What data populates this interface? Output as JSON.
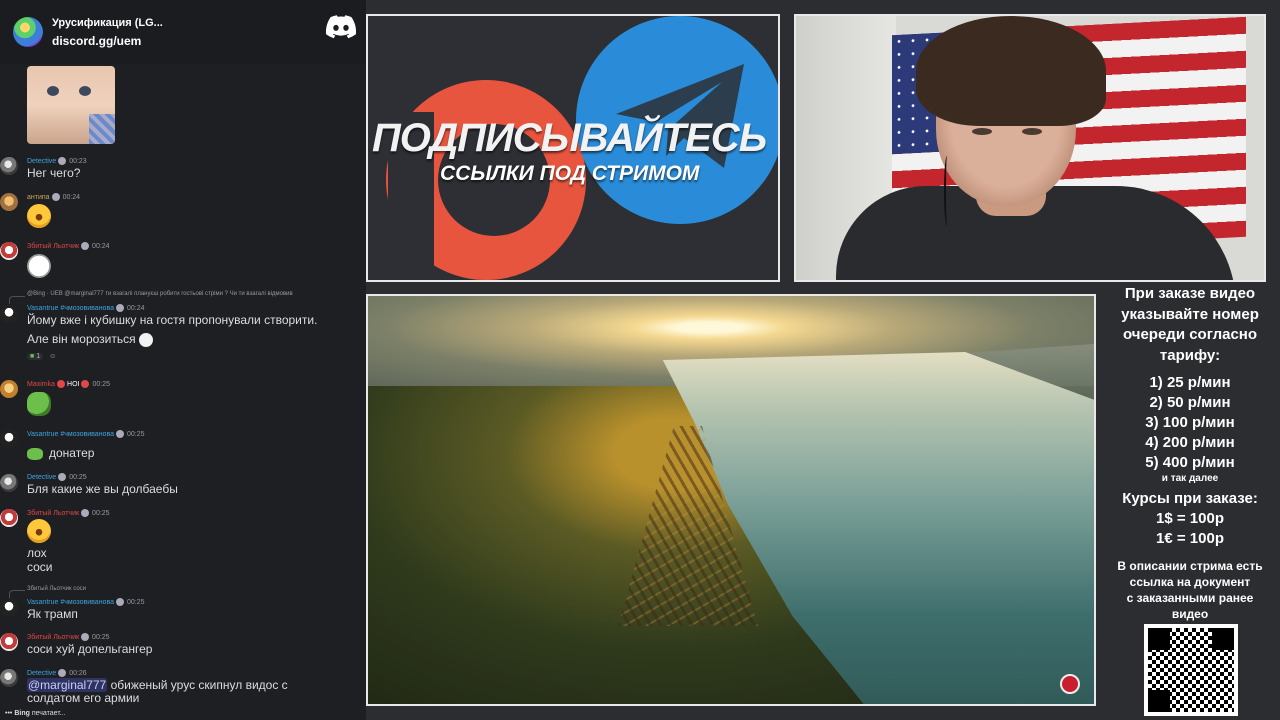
{
  "server": {
    "name": "Урусификация (LG...",
    "invite": "discord.gg/uem"
  },
  "messages": [
    {
      "user": "Detective",
      "time": "00:23",
      "text": "Нег чего?"
    },
    {
      "user": "антипа",
      "time": "00:24"
    },
    {
      "user": "Збитый Льотчик",
      "time": "00:24"
    },
    {
      "reply": "@Bing · UEB @marginal777 ти взагалі плануєш робити гостьові стріми ? Чи ти взагалі відмовив",
      "user": "Vasantrue #чмозовиванова",
      "time": "00:24",
      "lines": [
        "Йому вже і кубишку на гостя пропонували створити.",
        "Але він морозиться"
      ],
      "reaction_count": "1"
    },
    {
      "user": "Maximka",
      "badge": "HOI",
      "time": "00:25"
    },
    {
      "user": "Vasantrue #чмозовиванова",
      "time": "00:25",
      "text": "донатер"
    },
    {
      "user": "Detective",
      "time": "00:25",
      "text": "Бля какие же вы долбаебы"
    },
    {
      "user": "Збитый Льотчик",
      "time": "00:25",
      "lines": [
        "лох",
        "соси"
      ]
    },
    {
      "reply": "Збитый Льотчик соси",
      "user": "Vasantrue #чмозовиванова",
      "time": "00:25",
      "text": "Як трамп"
    },
    {
      "user": "Збитый Льотчик",
      "time": "00:25",
      "text": "соси хуй допельгангер"
    },
    {
      "user": "Detective",
      "time": "00:26",
      "mention": "@marginal777",
      "lines": [
        " обиженый урус скипнул видос с",
        "солдатом его армии"
      ]
    }
  ],
  "typing": {
    "user": "Bing",
    "suffix": " печатает..."
  },
  "promo": {
    "title": "ПОДПИСЫВАЙТЕСЬ",
    "subtitle": "ССЫЛКИ ПОД СТРИМОМ"
  },
  "info": {
    "title_lines": [
      "При заказе видео",
      "указывайте номер",
      "очереди согласно",
      "тарифу:"
    ],
    "tariffs": [
      "1) 25 р/мин",
      "2) 50 р/мин",
      "3) 100 р/мин",
      "4) 200 р/мин",
      "5) 400 р/мин"
    ],
    "etc": "и так далее",
    "rates_title": "Курсы при заказе:",
    "rates": [
      "1$ = 100р",
      "1€ = 100р"
    ],
    "desc_lines": [
      "В описании стрима есть",
      "ссылка на документ",
      "с заказанными ранее",
      "видео"
    ]
  },
  "colors": {
    "patreon": "#e8553e",
    "telegram": "#2a8cd8",
    "discord": "#ffffff"
  },
  "icons": [
    "discord-logo-icon",
    "patreon-logo-icon",
    "telegram-logo-icon",
    "video-logo-icon",
    "qr-code"
  ]
}
